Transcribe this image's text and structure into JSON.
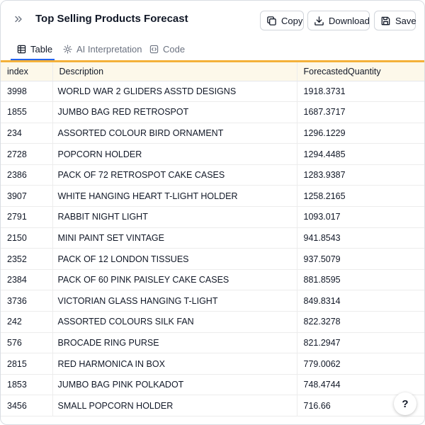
{
  "header": {
    "title": "Top Selling Products Forecast",
    "copy_label": "Copy",
    "download_label": "Download",
    "save_label": "Save"
  },
  "tabs": [
    {
      "label": "Table",
      "icon": "table-icon",
      "active": true
    },
    {
      "label": "AI Interpretation",
      "icon": "sparkle-icon",
      "active": false
    },
    {
      "label": "Code",
      "icon": "code-icon",
      "active": false
    }
  ],
  "colors": {
    "accent": "#f4b13a",
    "active_tab": "#2563eb",
    "header_bg": "#fdf8ea"
  },
  "table": {
    "columns": [
      "index",
      "Description",
      "ForecastedQuantity"
    ],
    "rows": [
      [
        "3998",
        "WORLD WAR 2 GLIDERS ASSTD DESIGNS",
        "1918.3731"
      ],
      [
        "1855",
        "JUMBO BAG RED RETROSPOT",
        "1687.3717"
      ],
      [
        "234",
        "ASSORTED COLOUR BIRD ORNAMENT",
        "1296.1229"
      ],
      [
        "2728",
        "POPCORN HOLDER",
        "1294.4485"
      ],
      [
        "2386",
        "PACK OF 72 RETROSPOT CAKE CASES",
        "1283.9387"
      ],
      [
        "3907",
        "WHITE HANGING HEART T-LIGHT HOLDER",
        "1258.2165"
      ],
      [
        "2791",
        "RABBIT NIGHT LIGHT",
        "1093.017"
      ],
      [
        "2150",
        "MINI PAINT SET VINTAGE",
        "941.8543"
      ],
      [
        "2352",
        "PACK OF 12 LONDON TISSUES",
        "937.5079"
      ],
      [
        "2384",
        "PACK OF 60 PINK PAISLEY CAKE CASES",
        "881.8595"
      ],
      [
        "3736",
        "VICTORIAN GLASS HANGING T-LIGHT",
        "849.8314"
      ],
      [
        "242",
        "ASSORTED COLOURS SILK FAN",
        "822.3278"
      ],
      [
        "576",
        "BROCADE RING PURSE",
        "821.2947"
      ],
      [
        "2815",
        "RED  HARMONICA IN BOX",
        "779.0062"
      ],
      [
        "1853",
        "JUMBO BAG PINK POLKADOT",
        "748.4744"
      ],
      [
        "3456",
        "SMALL POPCORN HOLDER",
        "716.66"
      ]
    ]
  },
  "help": {
    "label": "?"
  }
}
